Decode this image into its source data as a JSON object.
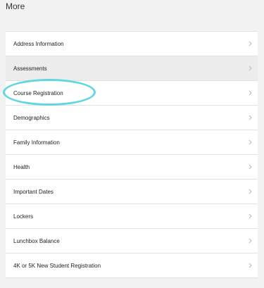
{
  "header": {
    "title": "More"
  },
  "menu": {
    "items": [
      {
        "label": "Address Information"
      },
      {
        "label": "Assessments"
      },
      {
        "label": "Course Registration"
      },
      {
        "label": "Demographics"
      },
      {
        "label": "Family Information"
      },
      {
        "label": "Health"
      },
      {
        "label": "Important Dates"
      },
      {
        "label": "Lockers"
      },
      {
        "label": "Lunchbox Balance"
      },
      {
        "label": "4K or 5K New Student Registration"
      }
    ],
    "chevron_icon": "chevron-right-icon"
  },
  "colors": {
    "background": "#f2f2f2",
    "row_background": "#ffffff",
    "active_row_background": "#ececec",
    "highlight": "#60d6e0"
  }
}
